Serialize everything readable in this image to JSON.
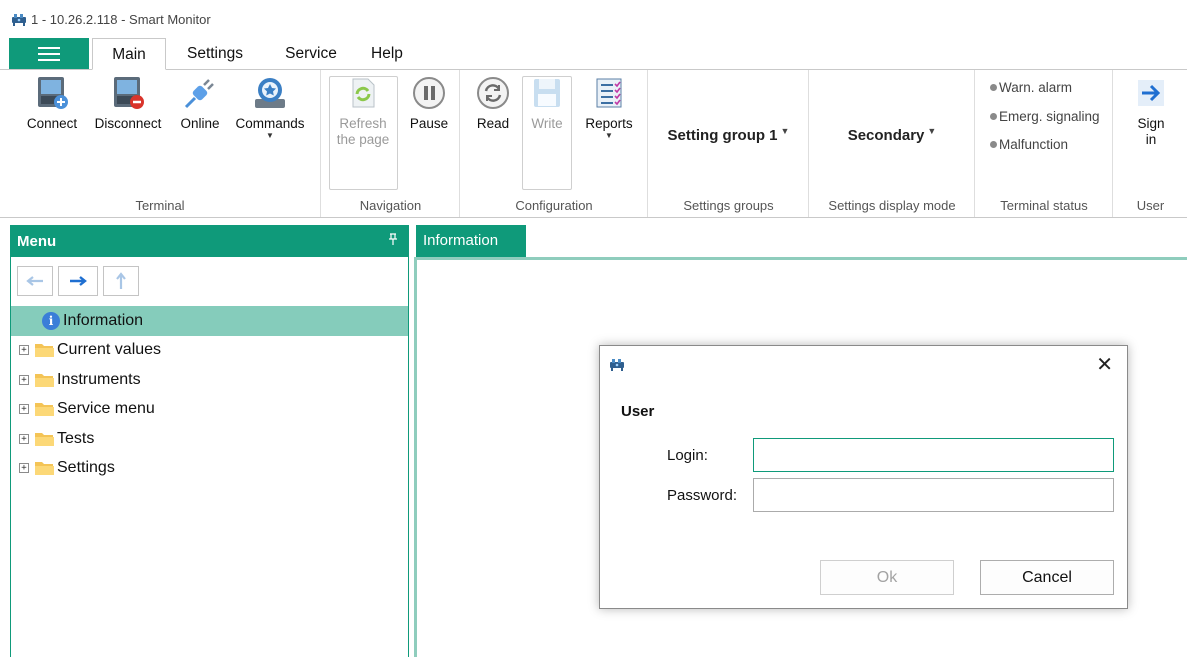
{
  "window": {
    "title": "1 - 10.26.2.118 - Smart Monitor",
    "app_icon": "network-device-icon"
  },
  "ribbon_tabs": [
    {
      "label": "Main",
      "active": true
    },
    {
      "label": "Settings",
      "active": false
    },
    {
      "label": "Service",
      "active": false
    },
    {
      "label": "Help",
      "active": false
    }
  ],
  "ribbon": {
    "terminal": {
      "label": "Terminal",
      "buttons": [
        {
          "label": "Connect",
          "icon": "connect-icon"
        },
        {
          "label": "Disconnect",
          "icon": "disconnect-icon"
        },
        {
          "label": "Online",
          "icon": "plug-icon"
        },
        {
          "label": "Commands",
          "icon": "commands-icon"
        }
      ]
    },
    "navigation": {
      "label": "Navigation",
      "refresh_label_1": "Refresh",
      "refresh_label_2": "the page",
      "pause_label": "Pause"
    },
    "configuration": {
      "label": "Configuration",
      "read_label": "Read",
      "write_label": "Write",
      "reports_label": "Reports"
    },
    "settings_groups": {
      "label": "Settings groups",
      "value": "Setting group 1"
    },
    "display_mode": {
      "label": "Settings display mode",
      "value": "Secondary"
    },
    "terminal_status": {
      "label": "Terminal status",
      "items": [
        "Warn. alarm",
        "Emerg. signaling",
        "Malfunction"
      ]
    },
    "user": {
      "label": "User",
      "sign_in_1": "Sign",
      "sign_in_2": "in"
    }
  },
  "menu_panel": {
    "title": "Menu",
    "pin": "⮌",
    "tree": [
      {
        "label": "Information",
        "selected": true
      },
      {
        "label": "Current values"
      },
      {
        "label": "Instruments"
      },
      {
        "label": "Service menu"
      },
      {
        "label": "Tests"
      },
      {
        "label": "Settings"
      }
    ]
  },
  "document": {
    "tab_label": "Information"
  },
  "dialog": {
    "heading": "User",
    "login_label": "Login:",
    "login_value": "",
    "password_label": "Password:",
    "password_value": "",
    "ok_label": "Ok",
    "cancel_label": "Cancel",
    "close_glyph": "✕"
  },
  "colors": {
    "accent": "#0f9a7a",
    "selection": "#85ccbb",
    "tab_border": "#8fcdbd"
  }
}
